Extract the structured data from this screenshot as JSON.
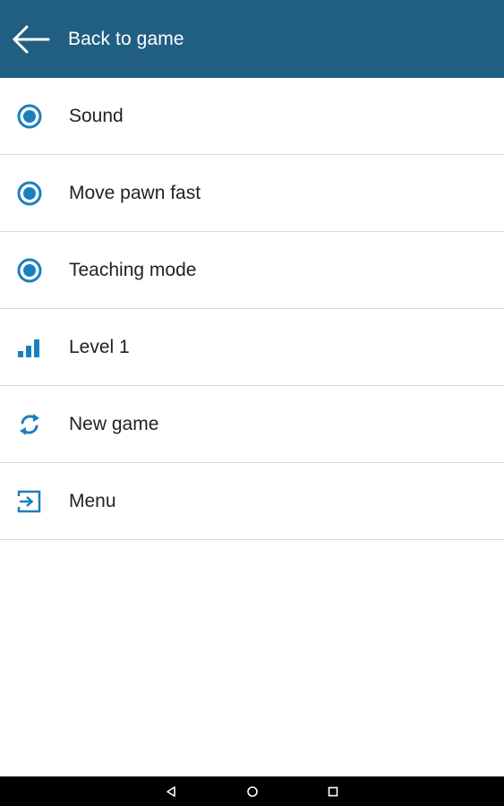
{
  "header": {
    "back_label": "Back to game",
    "background_color": "#215f82"
  },
  "menu": {
    "accent_color": "#1a7fc0",
    "items": [
      {
        "label": "Sound",
        "icon": "radio-selected-icon"
      },
      {
        "label": "Move pawn fast",
        "icon": "radio-selected-icon"
      },
      {
        "label": "Teaching mode",
        "icon": "radio-selected-icon"
      },
      {
        "label": "Level 1",
        "icon": "signal-bars-icon"
      },
      {
        "label": "New game",
        "icon": "refresh-icon"
      },
      {
        "label": "Menu",
        "icon": "exit-icon"
      }
    ]
  },
  "system_nav": {
    "buttons": [
      "back-triangle-icon",
      "home-circle-icon",
      "recents-square-icon"
    ]
  }
}
